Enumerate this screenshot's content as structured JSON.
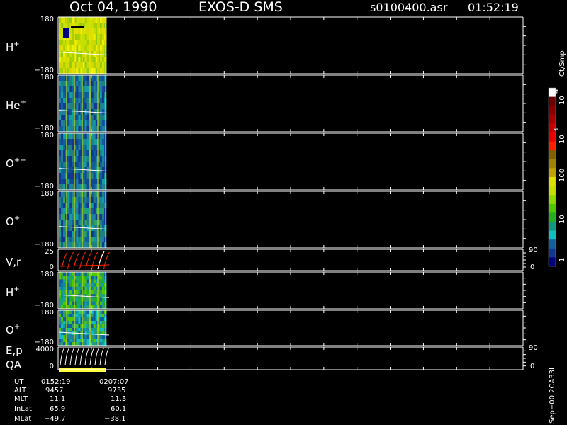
{
  "header": {
    "date": "Oct 04, 1990",
    "instrument": "EXOS-D SMS",
    "file": "s0100400.asr",
    "time": "01:52:19"
  },
  "panels": [
    {
      "id": "h-plus",
      "name": "H",
      "sup": "+",
      "ymax": "180",
      "ymin": "−180",
      "right": []
    },
    {
      "id": "he-plus",
      "name": "He",
      "sup": "+",
      "ymax": "180",
      "ymin": "−180",
      "right": []
    },
    {
      "id": "o-pp",
      "name": "O",
      "sup": "++",
      "ymax": "180",
      "ymin": "−180",
      "right": []
    },
    {
      "id": "o-plus",
      "name": "O",
      "sup": "+",
      "ymax": "180",
      "ymin": "−180",
      "right": []
    },
    {
      "id": "vr",
      "name": "V,r",
      "sup": "",
      "ymax": "25",
      "ymin": "0",
      "right": [
        "90",
        "0"
      ]
    },
    {
      "id": "h-plus-2",
      "name": "H",
      "sup": "+",
      "ymax": "180",
      "ymin": "−180",
      "right": []
    },
    {
      "id": "o-plus-2",
      "name": "O",
      "sup": "+",
      "ymax": "180",
      "ymin": "−180",
      "right": []
    },
    {
      "id": "ep-qa",
      "name": "E,p",
      "name2": "QA",
      "sup": "",
      "ymax": "4000",
      "ymin": "0",
      "right": [
        "90",
        "0"
      ]
    }
  ],
  "colorbar": {
    "unit": "Ct/Smp",
    "labels": [
      "10",
      "4",
      "10",
      "3",
      "100",
      "10",
      "1"
    ],
    "colors": [
      "#ffffff",
      "#6b0000",
      "#8a0000",
      "#a80000",
      "#c80000",
      "#e80000",
      "#ff2000",
      "#806000",
      "#a08000",
      "#c0a000",
      "#e0e000",
      "#c8e000",
      "#90d800",
      "#50c800",
      "#20b020",
      "#109880",
      "#10c0c0",
      "#1060a0",
      "#103890",
      "#000080"
    ]
  },
  "footer": {
    "rows": [
      {
        "label": "UT",
        "v1": "0152:19",
        "v2": "0207:07"
      },
      {
        "label": "ALT",
        "v1": "9457",
        "v2": "9735"
      },
      {
        "label": "MLT",
        "v1": "11.1",
        "v2": "11.3"
      },
      {
        "label": "InLat",
        "v1": "65.9",
        "v2": "60.1"
      },
      {
        "label": "MLat",
        "v1": "−49.7",
        "v2": "−38.1"
      }
    ],
    "side_text": "Sep−00  2CA33L"
  },
  "chart_data": {
    "type": "heatmap",
    "title": "Oct 04, 1990   EXOS-D SMS",
    "panels": [
      "H+",
      "He+",
      "O++",
      "O+",
      "V,r",
      "H+",
      "O+",
      "E,p / QA"
    ],
    "time_range": [
      "0152:19",
      "0207:07"
    ],
    "y_range_angle": [
      -180,
      180
    ],
    "vr_range": [
      0,
      25
    ],
    "ep_range": [
      0,
      4000
    ],
    "color_scale": "log",
    "color_range_ct_per_smp": [
      1,
      10000
    ],
    "colorbar_unit": "Ct/Smp"
  }
}
